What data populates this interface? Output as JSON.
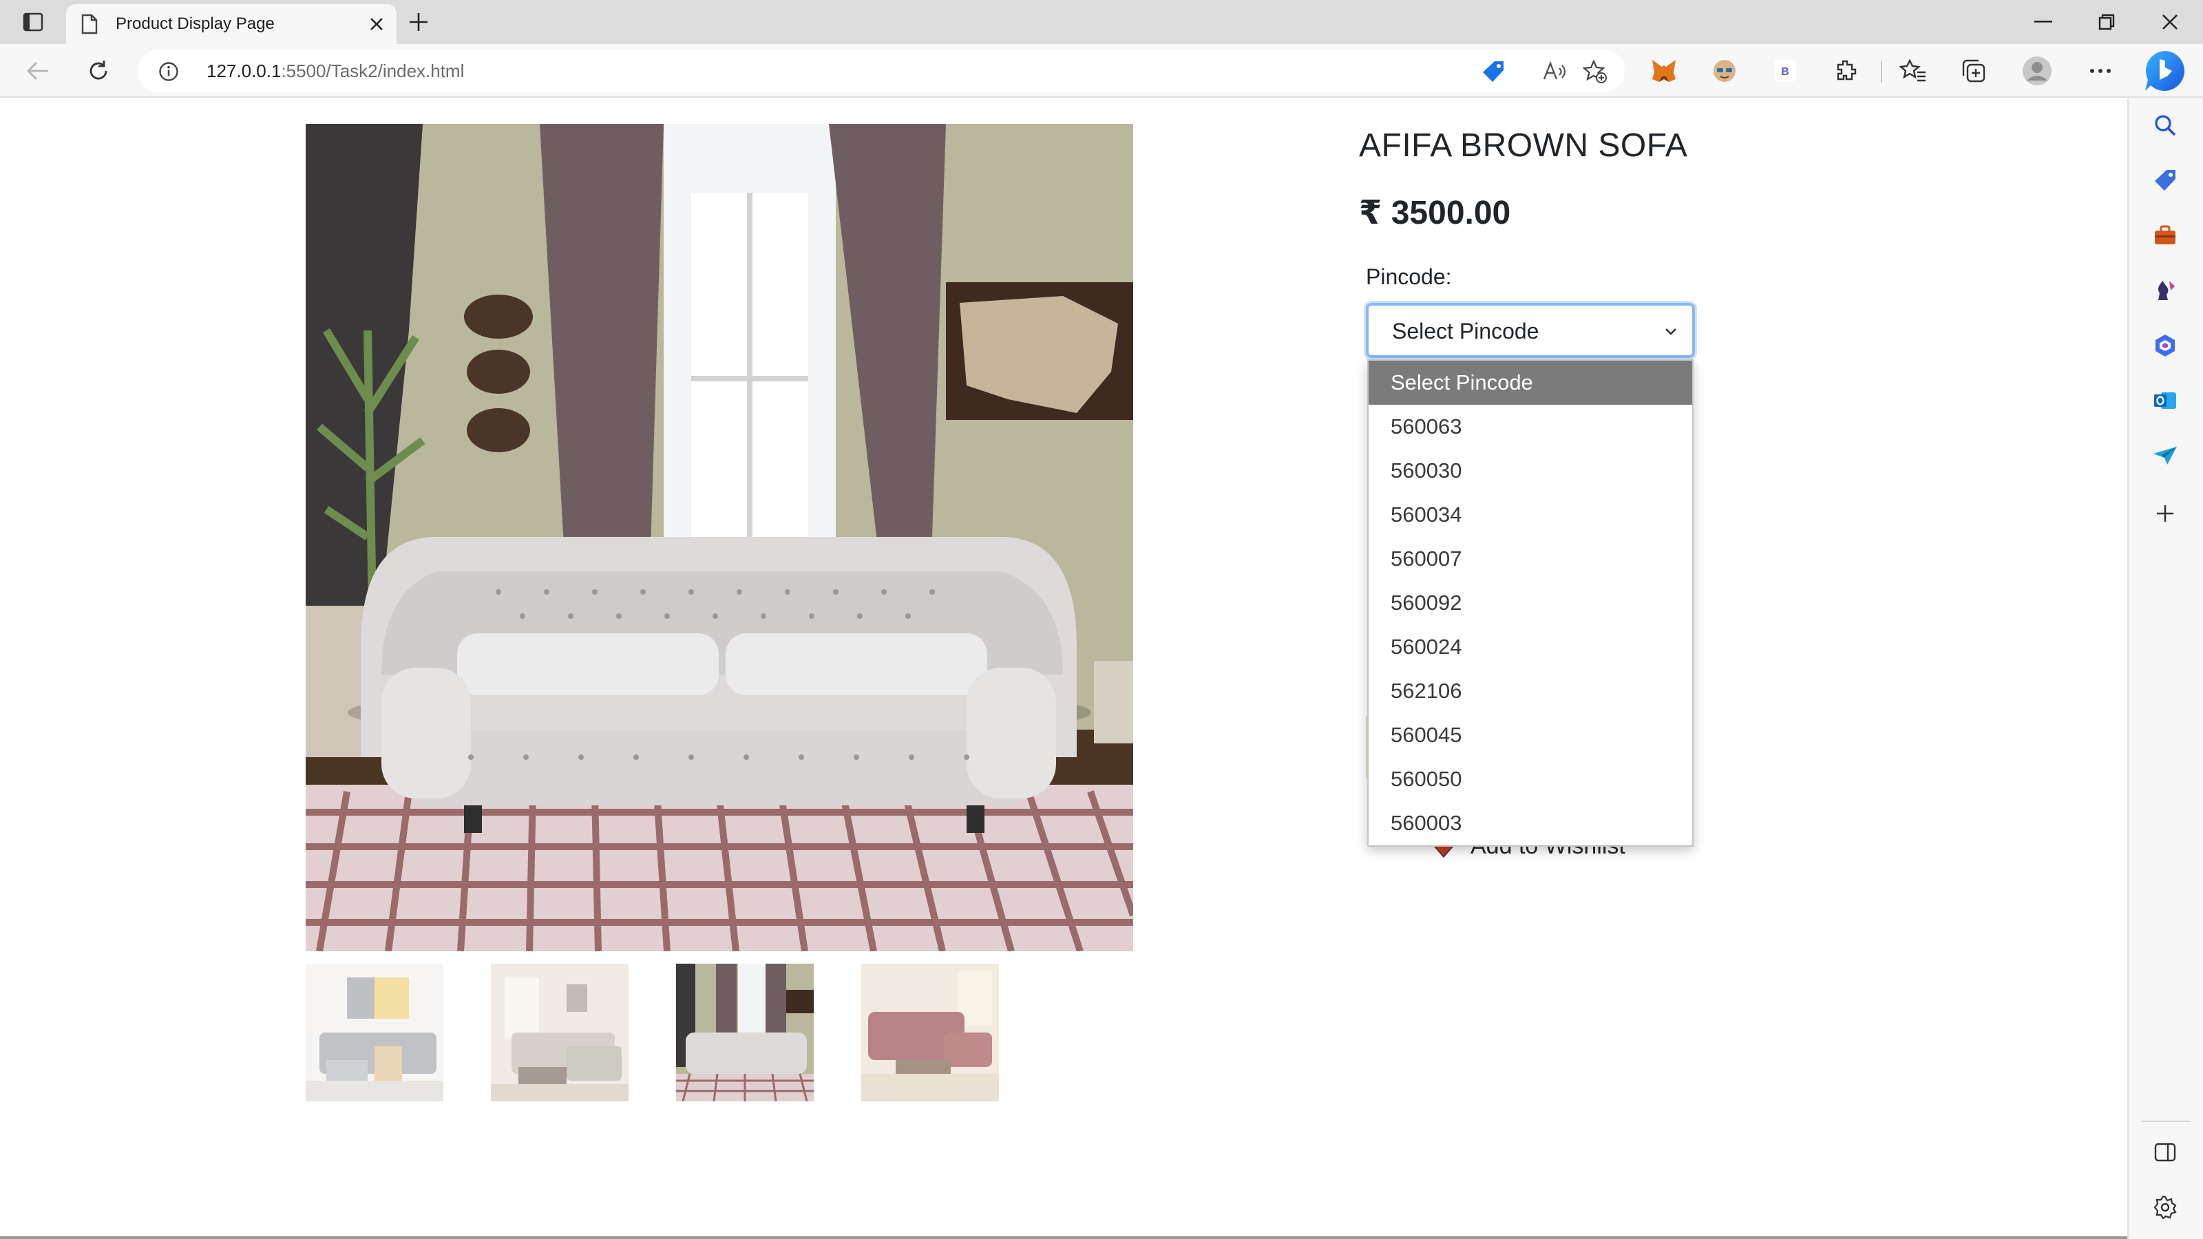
{
  "browser": {
    "tab_title": "Product Display Page",
    "url_host": "127.0.0.1",
    "url_rest": ":5500/Task2/index.html",
    "toolbar_icons": [
      "back-icon",
      "refresh-icon",
      "site-info-icon",
      "coupon-icon",
      "read-aloud-icon",
      "favorite-add-icon",
      "metamask-extension-icon",
      "avatar-extension-icon",
      "b-extension-icon",
      "extensions-icon",
      "favorites-icon",
      "collections-icon",
      "profile-icon",
      "more-icon"
    ],
    "sidebar_icons": [
      "search-icon",
      "shopping-tag-icon",
      "tools-icon",
      "games-icon",
      "office-icon",
      "outlook-icon",
      "send-icon",
      "add-icon",
      "panel-toggle-icon",
      "settings-icon"
    ]
  },
  "product": {
    "title": "AFIFA BROWN SOFA",
    "price": "₹ 3500.00",
    "pincode_label": "Pincode:",
    "selected_pincode": "Select Pincode",
    "wishlist_label": "Add to Wishlist"
  },
  "dropdown": {
    "options": [
      "Select Pincode",
      "560063",
      "560030",
      "560034",
      "560007",
      "560092",
      "560024",
      "562106",
      "560045",
      "560050",
      "560003"
    ]
  },
  "colors": {
    "select_focus": "#86b7fe",
    "selected_option_bg": "#7b7b7b",
    "heart": "#c0392b"
  }
}
